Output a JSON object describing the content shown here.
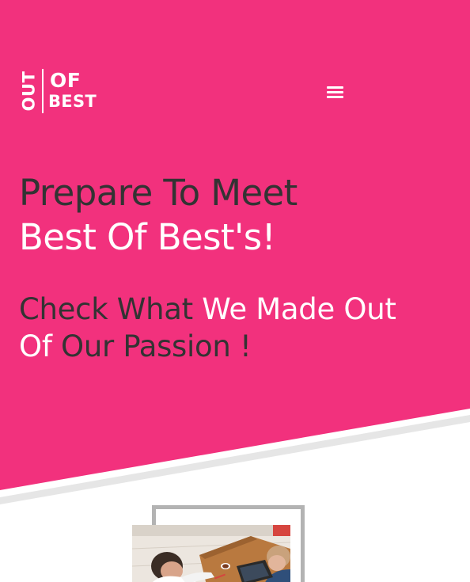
{
  "brand": {
    "logo_vertical": "OUT",
    "logo_top": "OF",
    "logo_bottom": "BEST",
    "accent_color": "#f2317d"
  },
  "header": {
    "menu_icon": "hamburger-menu-icon"
  },
  "hero": {
    "headline_line1": "Prepare To Meet",
    "headline_line2": "Best Of Best's!",
    "subhead_part1": "Check What ",
    "subhead_part2": "We Made Out",
    "subhead_part3": "Of ",
    "subhead_part4": "Our Passion !"
  },
  "showcase": {
    "image": "team-working-photo",
    "frame_color": "#b3b3b3"
  }
}
